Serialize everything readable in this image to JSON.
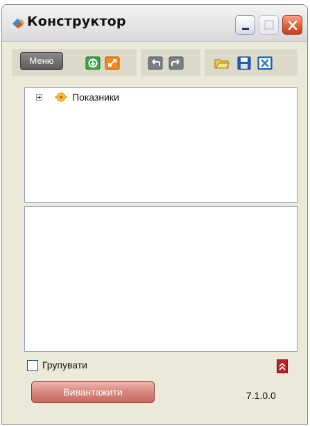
{
  "window": {
    "title": "Конструктор",
    "controls": [
      "minimize-button",
      "maximize-button",
      "close-button"
    ]
  },
  "toolbar": {
    "menu_label": "Меню",
    "icons": [
      "refresh-icon",
      "expand-icon",
      "undo-icon",
      "redo-icon",
      "open-folder-icon",
      "save-icon",
      "close-file-icon"
    ]
  },
  "tree": {
    "items": [
      {
        "label": "Показники",
        "expanded": false,
        "icon": "indicator-icon"
      }
    ]
  },
  "options": {
    "group_label": "Групувати",
    "group_checked": false
  },
  "footer": {
    "export_label": "Вивантажити",
    "version": "7.1.0.0"
  },
  "colors": {
    "window_bg": "#ece9d8",
    "panel_border": "#8d9fbf",
    "close_button": "#e05a33",
    "export_button": "#d98a82",
    "collapse_button": "#b6232b"
  }
}
